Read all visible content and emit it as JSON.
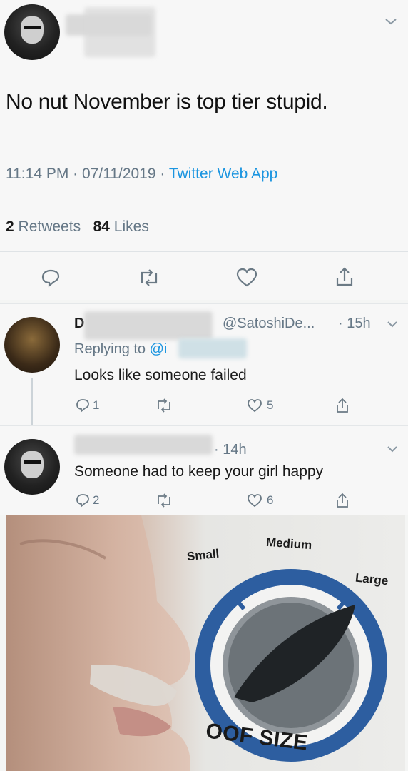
{
  "tweet": {
    "text": "No nut November is top tier stupid.",
    "time": "11:14 PM",
    "separator1": " · ",
    "date": "07/11/2019",
    "separator2": " · ",
    "source": "Twitter Web App",
    "retweets_count": "2",
    "retweets_label": "Retweets",
    "likes_count": "84",
    "likes_label": "Likes"
  },
  "reply1": {
    "name_initial": "D",
    "handle": "@SatoshiDe...",
    "time": "· 15h",
    "replying_prefix": "Replying to",
    "replying_handle": "@i",
    "text": "Looks like someone failed",
    "reply_count": "1",
    "like_count": "5"
  },
  "reply2": {
    "time": "· 14h",
    "text": "Someone had to keep your girl happy",
    "reply_count": "2",
    "like_count": "6"
  },
  "meme": {
    "label_small": "Small",
    "label_medium": "Medium",
    "label_large": "Large",
    "caption": "OOF SIZE"
  }
}
